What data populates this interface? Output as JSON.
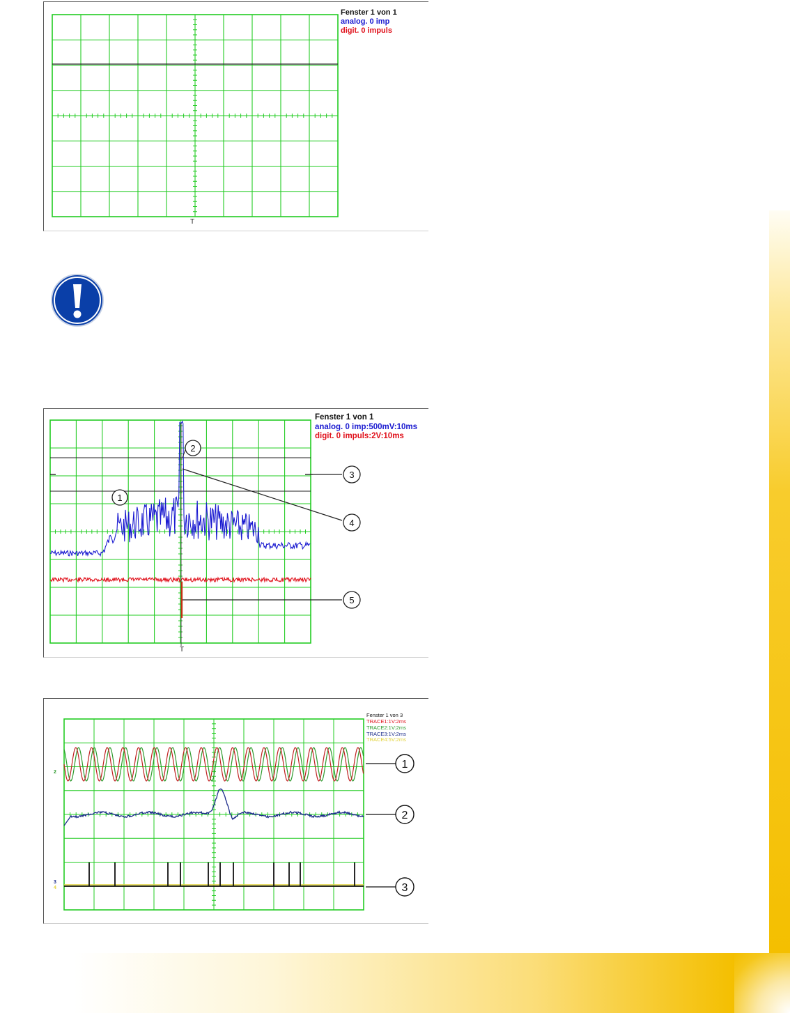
{
  "scope1": {
    "title": "Fenster 1 von 1",
    "analog": "analog. 0 imp",
    "digital": "digit. 0 impuls",
    "trigger_mark": "T"
  },
  "scope2": {
    "title": "Fenster 1 von 1",
    "analog": "analog. 0 imp:500mV:10ms",
    "digital": "digit. 0 impuls:2V:10ms",
    "trigger_mark": "T",
    "callouts": [
      "1",
      "2",
      "3",
      "4",
      "5"
    ]
  },
  "scope3": {
    "title": "Fenster 1 von 3",
    "traces": [
      "TRACE1:1V:2ms",
      "TRACE2:1V:2ms",
      "TRACE3:1V:2ms",
      "TRACE4:5V:2ms"
    ],
    "channel_marks": [
      "2",
      "3",
      "4"
    ],
    "callouts": [
      "1",
      "2",
      "3"
    ]
  },
  "colors": {
    "grid": "#22cc22",
    "analog": "#1a1ad0",
    "digital": "#e0101a",
    "accent": "#f4bf00",
    "icon": "#0a3fa8"
  },
  "icons": {
    "note": "exclamation-icon"
  }
}
